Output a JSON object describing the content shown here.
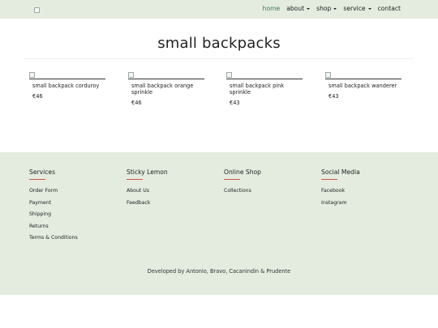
{
  "nav": {
    "items": [
      {
        "label": "home",
        "active": true,
        "dropdown": false
      },
      {
        "label": "about",
        "active": false,
        "dropdown": true
      },
      {
        "label": "shop",
        "active": false,
        "dropdown": true
      },
      {
        "label": "service",
        "active": false,
        "dropdown": true
      },
      {
        "label": "contact",
        "active": false,
        "dropdown": false
      }
    ],
    "active_color": "#2e7d6a"
  },
  "page": {
    "title": "small backpacks"
  },
  "products": [
    {
      "name": "small backpack corduroy",
      "price": "€46"
    },
    {
      "name": "small backpack orange sprinkle",
      "price": "€46"
    },
    {
      "name": "small backpack pink sprinkle",
      "price": "€43"
    },
    {
      "name": "small backpack wanderer",
      "price": "€43"
    }
  ],
  "footer": {
    "columns": [
      {
        "title": "Services",
        "links": [
          "Order Form",
          "Payment",
          "Shipping",
          "Returns",
          "Terms & Conditions"
        ]
      },
      {
        "title": "Sticky Lemon",
        "links": [
          "About Us",
          "Feedback"
        ]
      },
      {
        "title": "Online Shop",
        "links": [
          "Collections"
        ]
      },
      {
        "title": "Social Media",
        "links": [
          "Facebook",
          "Instagram"
        ]
      }
    ],
    "credit": "Developed by Antonio, Bravo, Cacanindin & Prudente",
    "background": "#e3ecdf",
    "accent": "#d9534f"
  }
}
